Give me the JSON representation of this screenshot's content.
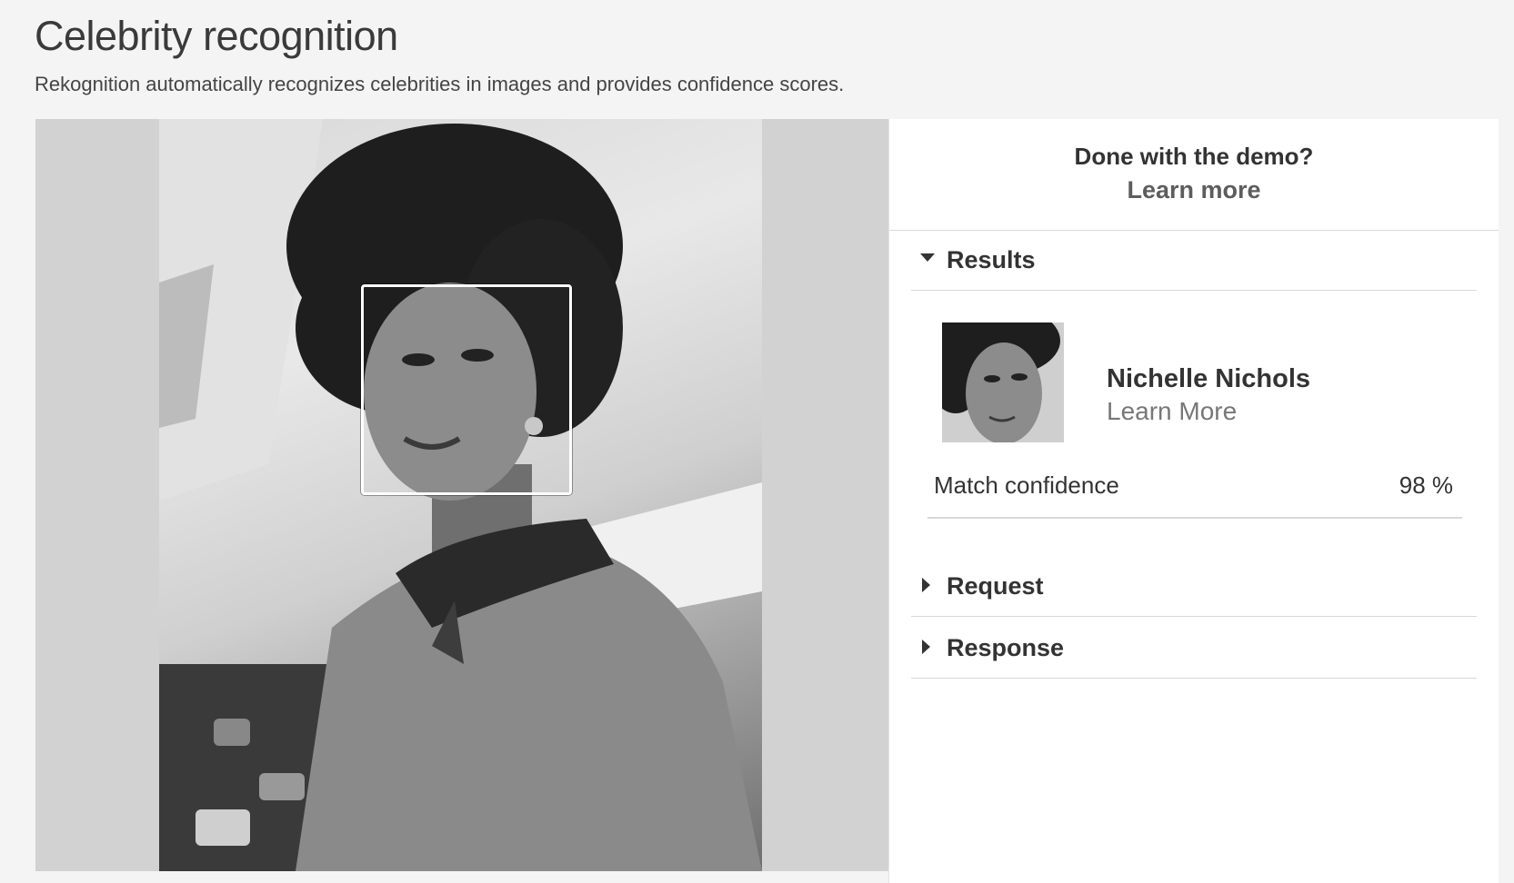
{
  "header": {
    "title": "Celebrity recognition",
    "subtitle": "Rekognition automatically recognizes celebrities in images and provides confidence scores."
  },
  "demo": {
    "question": "Done with the demo?",
    "link": "Learn more"
  },
  "sections": {
    "results": {
      "label": "Results",
      "expanded": true
    },
    "request": {
      "label": "Request",
      "expanded": false
    },
    "response": {
      "label": "Response",
      "expanded": false
    }
  },
  "result": {
    "name": "Nichelle Nichols",
    "link": "Learn More",
    "confidence_label": "Match confidence",
    "confidence_value": "98 %"
  }
}
